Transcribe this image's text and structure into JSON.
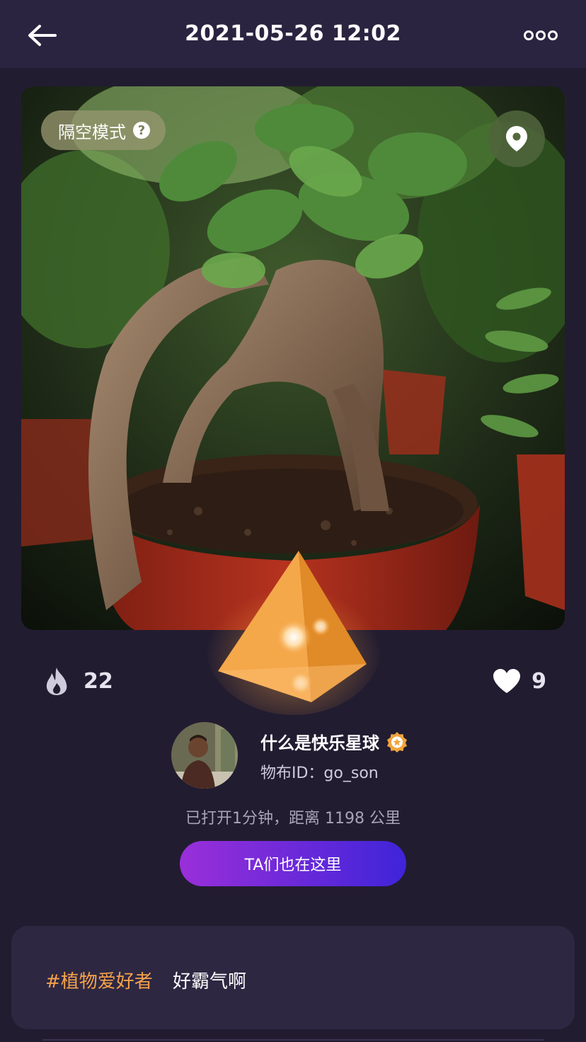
{
  "header": {
    "title": "2021-05-26 12:02",
    "back_icon": "arrow-left-icon",
    "more_icon": "more-dots-icon"
  },
  "photo": {
    "mode_label": "隔空模式",
    "help_icon": "?",
    "location_icon": "location-pin-icon"
  },
  "stats": {
    "heat_icon": "fire-icon",
    "heat_count": "22",
    "like_icon": "heart-icon",
    "like_count": "9"
  },
  "user": {
    "name": "什么是快乐星球",
    "verified_icon": "verified-badge-icon",
    "id_label": "物布ID：go_son",
    "open_info": "已打开1分钟，距离 1198 公里",
    "here_button": "TA们也在这里"
  },
  "post": {
    "tag": "#植物爱好者",
    "text": "好霸气啊"
  },
  "colors": {
    "background": "#221c31",
    "header": "#2b2440",
    "card": "#2e2742",
    "tag": "#f5a24b",
    "button_start": "#9a2fd9",
    "button_end": "#3f24d9",
    "pyramid": "#f2a03d"
  }
}
